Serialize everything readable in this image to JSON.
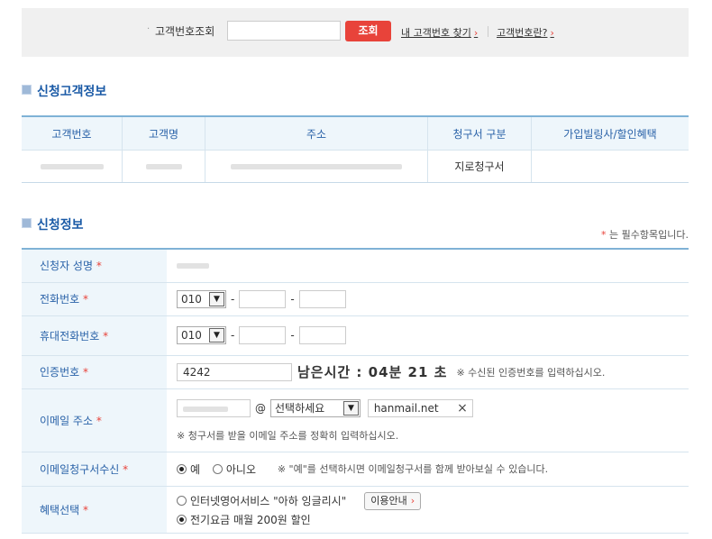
{
  "lookup": {
    "bullet": "·",
    "label": "고객번호조회",
    "input_value": "",
    "search_button": "조회",
    "find_link": "내 고객번호 찾기",
    "what_link": "고객번호란?",
    "chevron": "›"
  },
  "customer_section": {
    "title": "신청고객정보",
    "columns": [
      "고객번호",
      "고객명",
      "주소",
      "청구서 구분",
      "가입빌링사/할인혜택"
    ],
    "row": {
      "billing_type": "지로청구서",
      "benefit": ""
    }
  },
  "apply_section": {
    "title": "신청정보",
    "required_star": "*",
    "required_note": " 는 필수항목입니다."
  },
  "form": {
    "name_label": "신청자 성명",
    "phone_label": "전화번호",
    "phone_prefix": "010",
    "mobile_label": "휴대전화번호",
    "mobile_prefix": "010",
    "dash": "-",
    "auth_label": "인증번호",
    "auth_value": "4242",
    "timer": "남은시간 : 04분 21 초",
    "auth_hint": "※ 수신된 인증번호를 입력하십시오.",
    "email_label": "이메일 주소",
    "at": "@",
    "domain_select": "선택하세요",
    "domain_value": "hanmail.net",
    "clear": "×",
    "email_hint": "※ 청구서를 받을 이메일 주소를 정확히 입력하십시오.",
    "ebill_label": "이메일청구서수신",
    "yes": "예",
    "no": "아니오",
    "ebill_hint": "※ \"예\"를 선택하시면 이메일청구서를 함께 받아보실 수 있습니다.",
    "benefit_label": "혜택선택",
    "benefit_option1": "인터넷영어서비스 \"아하 잉글리시\"",
    "benefit_guide_button": "이용안내",
    "benefit_option2": "전기요금 매월 200원 할인"
  }
}
